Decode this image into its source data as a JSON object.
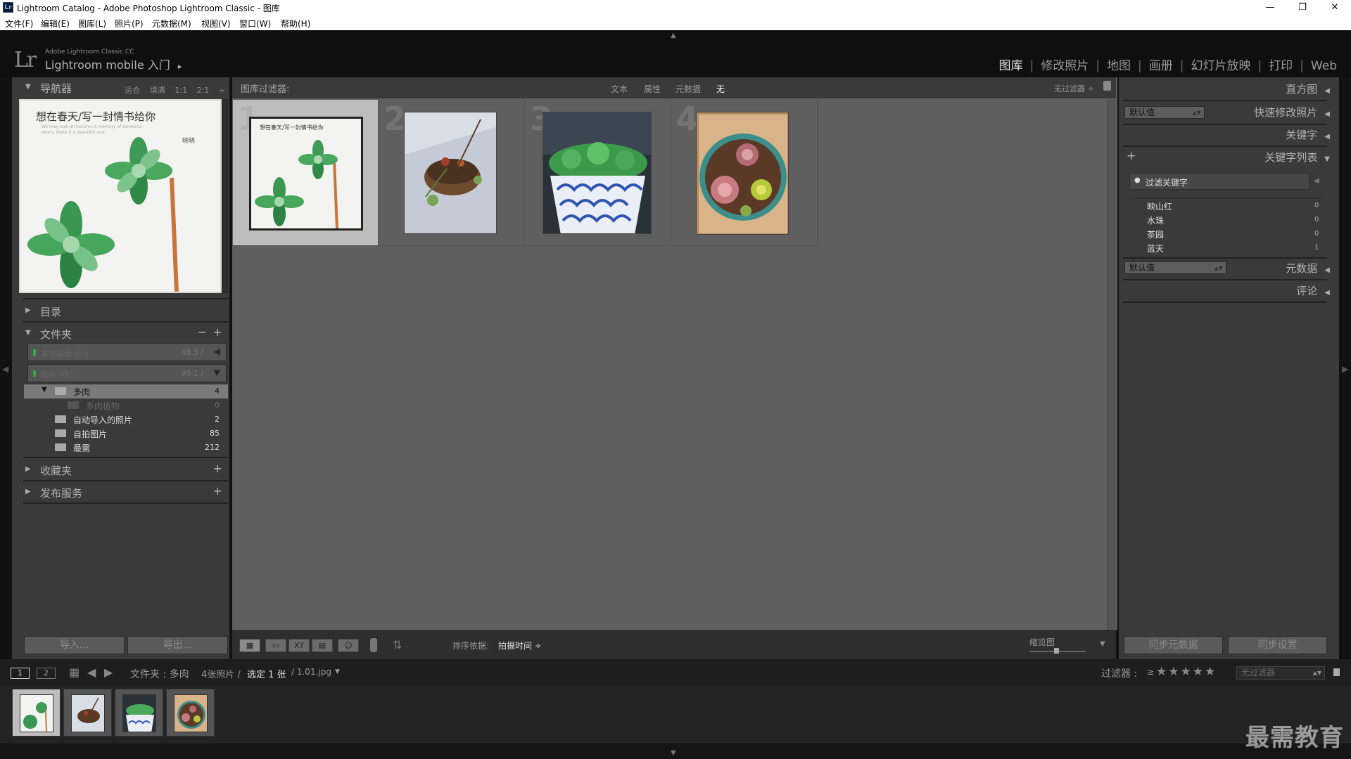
{
  "window": {
    "title": "Lightroom Catalog - Adobe Photoshop Lightroom Classic - 图库",
    "app_icon": "Lr",
    "controls": [
      "—",
      "❐",
      "✕"
    ]
  },
  "menu": [
    "文件(F)",
    "编辑(E)",
    "图库(L)",
    "照片(P)",
    "元数据(M)",
    "视图(V)",
    "窗口(W)",
    "帮助(H)"
  ],
  "identity": {
    "logo": "Lr",
    "product": "Adobe Lightroom Classic CC",
    "mobile": "Lightroom mobile 入门",
    "mobile_arrow": "▸"
  },
  "modules": {
    "items": [
      "图库",
      "修改照片",
      "地图",
      "画册",
      "幻灯片放映",
      "打印",
      "Web"
    ],
    "active": "图库",
    "separator": "|"
  },
  "left": {
    "navigator": {
      "label": "导航器",
      "zoom_options": [
        "适合",
        "填满",
        "1:1",
        "2:1"
      ],
      "zoom_spin": "÷",
      "preview_caption": "想在春天/写一封情书给你",
      "preview_sub": "We may well all become a memory of someone else's. Make it a beautiful one.",
      "preview_sign": "映晓"
    },
    "catalog_label": "目录",
    "folders_label": "文件夹",
    "folders_minus": "−",
    "folders_plus": "+",
    "drives": [
      {
        "name": "本地磁盘 (C:)",
        "value": "48.3 /"
      },
      {
        "name": "软件 (D:)",
        "value": "90.1 /"
      }
    ],
    "folders": [
      {
        "name": "多肉",
        "count": "4"
      },
      {
        "name": "多肉植物",
        "count": "0"
      },
      {
        "name": "自动导入的照片",
        "count": "2"
      },
      {
        "name": "自拍图片",
        "count": "85"
      },
      {
        "name": "最需",
        "count": "212"
      }
    ],
    "collections_label": "收藏夹",
    "publish_label": "发布服务",
    "import_button": "导入...",
    "export_button": "导出..."
  },
  "filter": {
    "label": "图库过滤器:",
    "tabs": [
      "文本",
      "属性",
      "元数据",
      "无"
    ],
    "active_tab": "无",
    "preset": "无过滤器 ÷"
  },
  "grid": {
    "cells": [
      {
        "num": "1",
        "caption": "想在春天/写一封情书给你"
      },
      {
        "num": "2",
        "caption": ""
      },
      {
        "num": "3",
        "caption": ""
      },
      {
        "num": "4",
        "caption": ""
      }
    ]
  },
  "toolbar": {
    "sort_label": "排序依据:",
    "sort_value": "拍摄时间 ÷",
    "thumb_label": "缩览图",
    "xy": "XY"
  },
  "right": {
    "histogram": "直方图",
    "quick_develop": "快速修改照片",
    "quick_preset": "默认值",
    "keywording": "关键字",
    "keyword_list": "关键字列表",
    "keyword_plus": "+",
    "keyword_filter": "过滤关键字",
    "keywords": [
      {
        "name": "映山红",
        "count": "0"
      },
      {
        "name": "水珠",
        "count": "0"
      },
      {
        "name": "茶园",
        "count": "0"
      },
      {
        "name": "蓝天",
        "count": "1"
      }
    ],
    "metadata_preset": "默认值",
    "metadata": "元数据",
    "comments": "评论",
    "sync_metadata": "同步元数据",
    "sync_settings": "同步设置"
  },
  "filmstrip": {
    "page1": "1",
    "page2": "2",
    "source_prefix": "文件夹 : ",
    "source": "多肉",
    "count": "4张照片 /",
    "selected": " 选定 1 张 ",
    "filename": "/ 1.01.jpg",
    "filter_label": "过滤器 :",
    "filter_ge": "≥",
    "stars": "★★★★★",
    "filter_value": "无过滤器"
  },
  "watermark": "最需教育"
}
